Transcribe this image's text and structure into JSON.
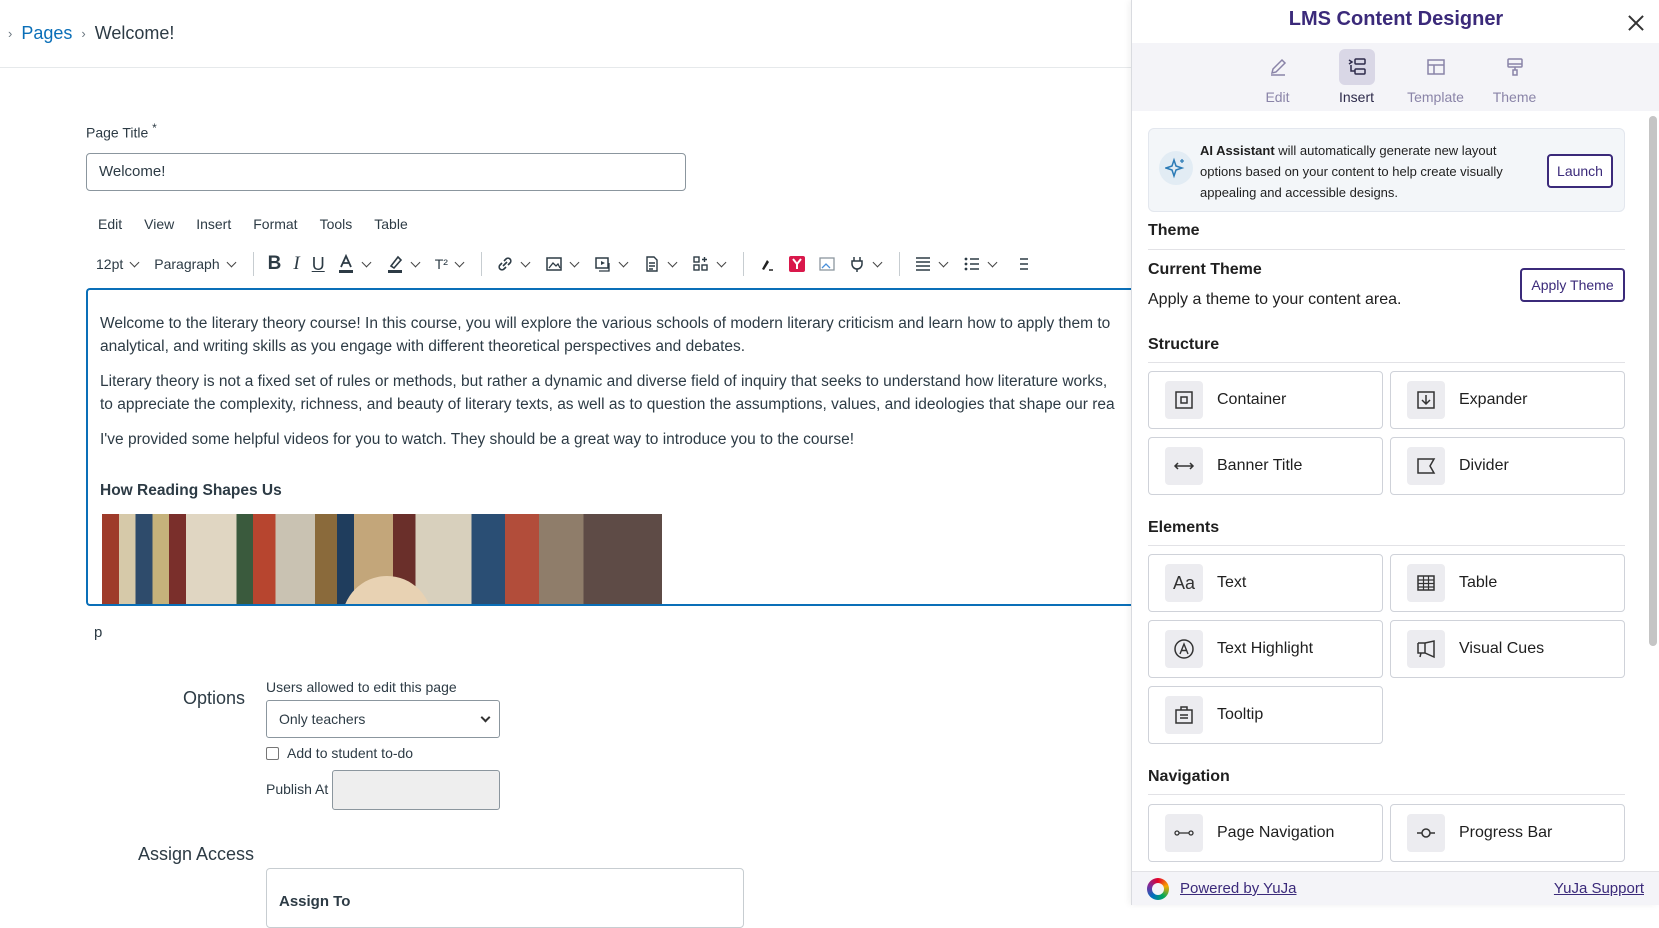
{
  "breadcrumb": {
    "link": "Pages",
    "current": "Welcome!"
  },
  "page_title": {
    "label": "Page Title",
    "required_mark": "*",
    "value": "Welcome!"
  },
  "editor_menu": [
    "Edit",
    "View",
    "Insert",
    "Format",
    "Tools",
    "Table"
  ],
  "toolbar": {
    "font_size": "12pt",
    "block_format": "Paragraph",
    "bold": "B",
    "italic": "I",
    "underline": "U",
    "superscript": "T²"
  },
  "content": {
    "p1a": "Welcome to the literary theory course! In this course, you will explore the various schools of modern literary criticism and learn how to apply them to",
    "p1b": "analytical, and writing skills as you engage with different theoretical perspectives and debates.",
    "p2a": "Literary theory is not a fixed set of rules or methods, but rather a dynamic and diverse field of inquiry that seeks to understand how literature works,",
    "p2b": "to appreciate the complexity, richness, and beauty of literary texts, as well as to question the assumptions, values, and ideologies that shape our rea",
    "p3": "I've provided some helpful videos for you to watch. They should be a great way to introduce you to the course!",
    "subheading": "How Reading Shapes Us"
  },
  "status_path": "p",
  "options": {
    "label": "Options",
    "users_label": "Users allowed to edit this page",
    "users_value": "Only teachers",
    "todo_label": "Add to student to-do",
    "publish_label": "Publish At",
    "assign_label": "Assign Access",
    "assign_to": "Assign To"
  },
  "panel": {
    "title": "LMS Content Designer",
    "tabs": [
      {
        "label": "Edit",
        "icon": "pencil-icon"
      },
      {
        "label": "Insert",
        "icon": "insert-icon"
      },
      {
        "label": "Template",
        "icon": "template-icon"
      },
      {
        "label": "Theme",
        "icon": "paint-brush-icon"
      }
    ],
    "active_tab": "Insert",
    "ai": {
      "strong": "AI Assistant",
      "text": " will automatically generate new layout options based on your content to help create visually appealing and accessible designs.",
      "launch": "Launch"
    },
    "theme_section": "Theme",
    "current_theme": "Current Theme",
    "theme_desc": "Apply a theme to your content area.",
    "apply_theme": "Apply Theme",
    "structure_section": "Structure",
    "structure": [
      "Container",
      "Expander",
      "Banner Title",
      "Divider"
    ],
    "elements_section": "Elements",
    "elements": [
      "Text",
      "Table",
      "Text Highlight",
      "Visual Cues",
      "Tooltip"
    ],
    "navigation_section": "Navigation",
    "navigation": [
      "Page Navigation",
      "Progress Bar"
    ],
    "footer": {
      "powered": "Powered by YuJa",
      "support": "YuJa Support"
    }
  },
  "colors": {
    "accent": "#3b2a7a",
    "link": "#0a6fb8",
    "focus": "#0a6fb8"
  }
}
